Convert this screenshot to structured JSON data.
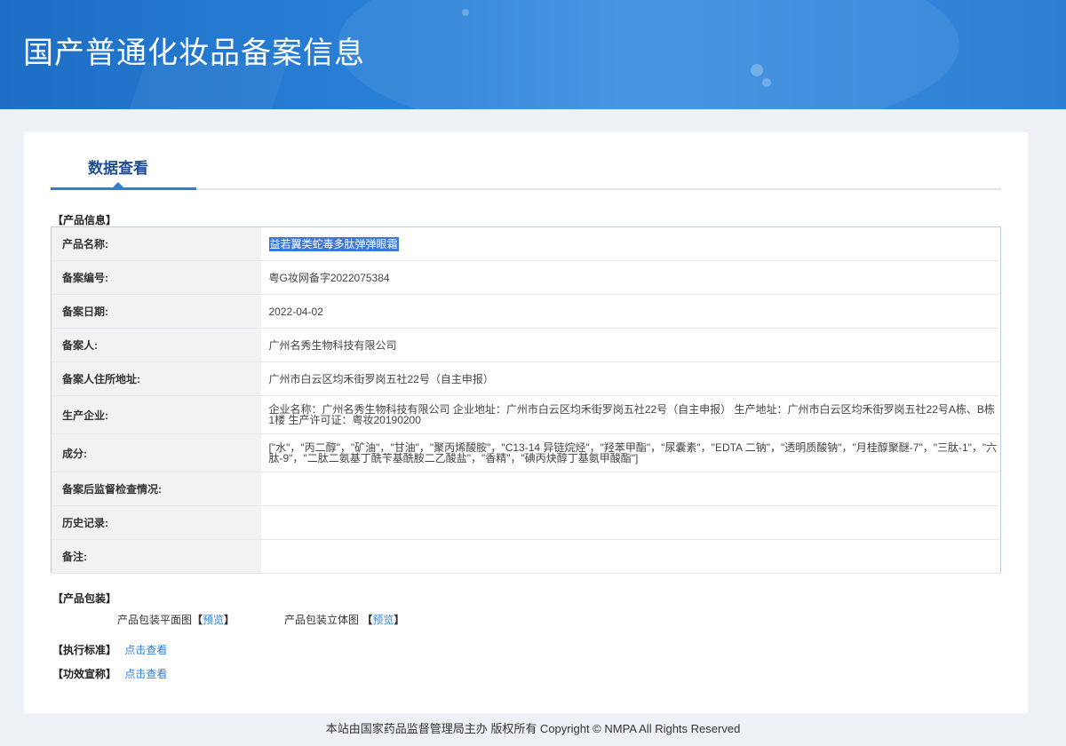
{
  "header": {
    "title": "国产普通化妆品备案信息"
  },
  "tab": {
    "label": "数据查看"
  },
  "product_info": {
    "section_title": "【产品信息】",
    "rows": [
      {
        "key": "产品名称:",
        "value": "益若翼类蛇毒多肽弹弹眼霜"
      },
      {
        "key": "备案编号:",
        "value": "粤G妆网备字2022075384"
      },
      {
        "key": "备案日期:",
        "value": "2022-04-02"
      },
      {
        "key": "备案人:",
        "value": "广州名秀生物科技有限公司"
      },
      {
        "key": "备案人住所地址:",
        "value": "广州市白云区均禾街罗岗五社22号（自主申报）"
      },
      {
        "key": "生产企业:",
        "value": "企业名称：广州名秀生物科技有限公司 企业地址：广州市白云区均禾街罗岗五社22号（自主申报） 生产地址：广州市白云区均禾街罗岗五社22号A栋、B栋1楼 生产许可证：粤妆20190200"
      },
      {
        "key": "成分:",
        "value": "[\"水\"，\"丙二醇\"，\"矿油\"，\"甘油\"，\"聚丙烯酸胺\"，\"C13-14 异链烷烃\"，\"羟苯甲酯\"，\"尿囊素\"，\"EDTA 二钠\"，\"透明质酸钠\"，\"月桂醇聚醚-7\"，\"三肽-1\"，\"六肽-9\"，\"二肽二氨基丁酰苄基酰胺二乙酸盐\"，\"香精\"，\"碘丙炔醇丁基氨甲酸酯\"]"
      },
      {
        "key": "备案后监督检查情况:",
        "value": ""
      },
      {
        "key": "历史记录:",
        "value": ""
      },
      {
        "key": "备注:",
        "value": ""
      }
    ]
  },
  "packaging": {
    "section_title": "【产品包装】",
    "flat_label": "产品包装平面图",
    "solid_label": "产品包装立体图",
    "bracket_open": "【",
    "bracket_close": "】",
    "preview": "预览"
  },
  "standard": {
    "label": "【执行标准】",
    "link": "点击查看"
  },
  "efficacy": {
    "label": "【功效宣称】",
    "link": "点击查看"
  },
  "footer": {
    "text": "本站由国家药品监督管理局主办 版权所有 Copyright © NMPA All Rights Reserved"
  },
  "colors": {
    "banner": "#2a82d8",
    "accent": "#2f7fd6",
    "tab_text": "#1e4f94"
  }
}
